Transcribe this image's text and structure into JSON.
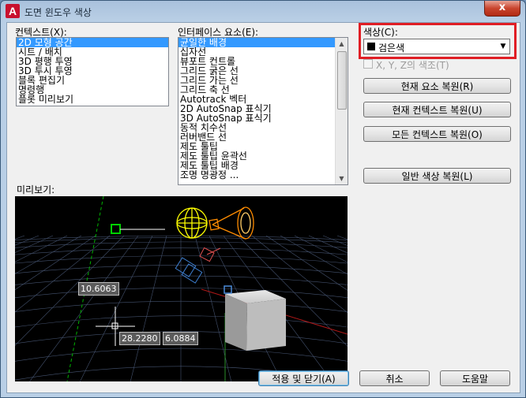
{
  "window": {
    "title": "도면 윈도우 색상",
    "close_glyph": "x",
    "app_icon_glyph": "A"
  },
  "context": {
    "label": "컨텍스트(X):",
    "items": [
      "2D 모형 공간",
      "시트 / 배치",
      "3D 평행 투영",
      "3D 투시 투영",
      "블록 편집기",
      "명령행",
      "플롯 미리보기"
    ],
    "selected_index": 0
  },
  "interface": {
    "label": "인터페이스 요소(E):",
    "items": [
      "균일한 배경",
      "십자선",
      "뷰포트 컨트롤",
      "그리드 굵은 선",
      "그리드 가는 선",
      "그리드 축 선",
      "Autotrack 벡터",
      "2D AutoSnap 표식기",
      "3D AutoSnap 표식기",
      "동적 치수선",
      "러버밴드 선",
      "제도 툴팁",
      "제도 툴팁 윤곽선",
      "제도 툴팁 배경",
      "조명 명광정 ..."
    ],
    "selected_index": 0
  },
  "color": {
    "label": "색상(C):",
    "value": "검은색",
    "swatch": "#000000"
  },
  "xyz_tint": {
    "label": "X, Y, Z의 색조(T)"
  },
  "buttons": {
    "restore_element": "현재 요소 복원(R)",
    "restore_context": "현재 컨텍스트 복원(U)",
    "restore_all": "모든 컨텍스트 복원(O)",
    "restore_classic": "일반 색상 복원(L)",
    "apply_close": "적용 및 닫기(A)",
    "cancel": "취소",
    "help": "도움말"
  },
  "preview": {
    "label": "미리보기:",
    "dim_a": "10.6063",
    "dim_b": "28.2280",
    "dim_c": "6.0884"
  },
  "colors": {
    "accent_red": "#e01e25",
    "selection": "#3399ff",
    "preview_bg": "#000000",
    "grid": "#4a5a78",
    "snap_green": "#00c000",
    "light_yellow": "#ffff00",
    "spot_orange": "#ff8c00"
  }
}
